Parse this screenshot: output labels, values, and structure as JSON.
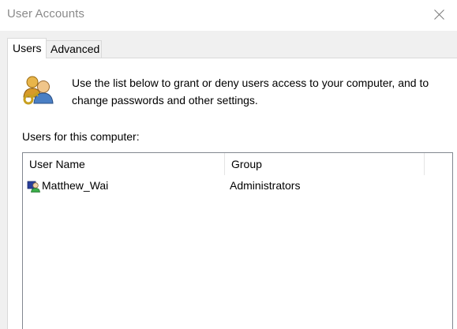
{
  "window": {
    "title": "User Accounts",
    "close_icon": "close-icon"
  },
  "tabs": [
    {
      "label": "Users",
      "selected": true
    },
    {
      "label": "Advanced",
      "selected": false
    }
  ],
  "users_tab": {
    "header_icon": "users-key-icon",
    "intro": "Use the list below to grant or deny users access to your computer, and to change passwords and other settings.",
    "list_label": "Users for this computer:",
    "columns": [
      "User Name",
      "Group"
    ],
    "rows": [
      {
        "icon": "user-account-icon",
        "user_name": "Matthew_Wai",
        "group": "Administrators"
      }
    ]
  },
  "colors": {
    "title_text": "#8a8a8a",
    "dialog_bg": "#f0f0f0",
    "panel_bg": "#ffffff",
    "border": "#d9d9d9",
    "list_border": "#828790"
  }
}
